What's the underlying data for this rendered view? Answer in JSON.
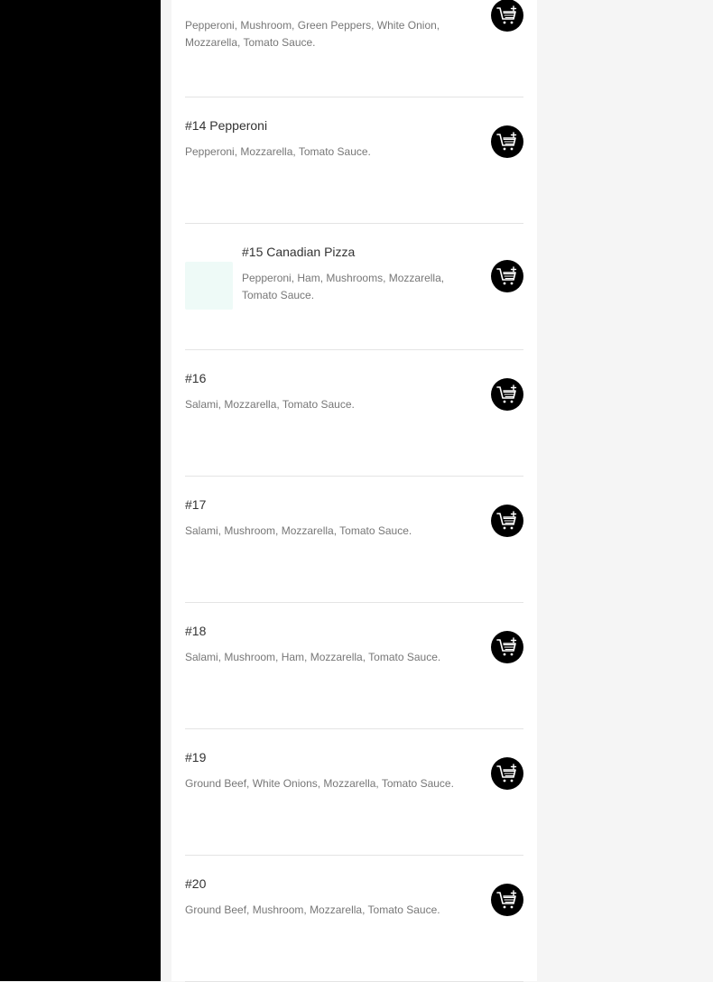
{
  "theme": {
    "sidebar_color": "#000000",
    "panel_color": "#ffffff",
    "cart_button_color": "#000000",
    "thumbnail_color": "#eefaf7"
  },
  "menu": {
    "items": [
      {
        "name": "",
        "description": "Pepperoni, Mushroom, Green Peppers, White Onion, Mozzarella, Tomato Sauce.",
        "cart_icon": "add-to-cart-icon"
      },
      {
        "name": "#14 Pepperoni",
        "description": "Pepperoni, Mozzarella, Tomato Sauce.",
        "cart_icon": "add-to-cart-icon"
      },
      {
        "name": "#15 Canadian Pizza",
        "description": "Pepperoni, Ham, Mushrooms, Mozzarella, Tomato Sauce.",
        "cart_icon": "add-to-cart-icon",
        "has_thumbnail": true
      },
      {
        "name": "#16",
        "description": "Salami, Mozzarella, Tomato Sauce.",
        "cart_icon": "add-to-cart-icon"
      },
      {
        "name": "#17",
        "description": "Salami, Mushroom, Mozzarella, Tomato Sauce.",
        "cart_icon": "add-to-cart-icon"
      },
      {
        "name": "#18",
        "description": "Salami, Mushroom, Ham, Mozzarella, Tomato Sauce.",
        "cart_icon": "add-to-cart-icon"
      },
      {
        "name": "#19",
        "description": "Ground Beef, White Onions, Mozzarella, Tomato Sauce.",
        "cart_icon": "add-to-cart-icon"
      },
      {
        "name": "#20",
        "description": "Ground Beef, Mushroom, Mozzarella, Tomato Sauce.",
        "cart_icon": "add-to-cart-icon"
      }
    ]
  }
}
